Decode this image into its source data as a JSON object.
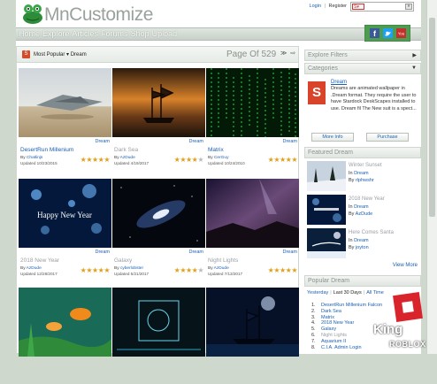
{
  "header": {
    "brand": "MnCustomize",
    "login": "Login",
    "separator": "|",
    "register": "Register",
    "search_scope": "S",
    "search_go": "»"
  },
  "nav": {
    "items": [
      "Home",
      "Explore",
      "Articles",
      "Forums",
      "Shop",
      "Upload"
    ]
  },
  "social": {
    "facebook": "f",
    "twitter": "t",
    "youtube": "You"
  },
  "toolbar": {
    "sort_label": "Most Popular",
    "category": "Dream",
    "pager": "Page Of 529",
    "arrows": "≫ ⇨"
  },
  "cards": [
    {
      "tag": "Dream",
      "title": "DesertRun Millenium",
      "author": "Chatlinjs",
      "updated": "Updated 10/23/2015",
      "rating": 5,
      "dim": false
    },
    {
      "tag": "Dream",
      "title": "Dark Sea",
      "author": "AzDude",
      "updated": "Updated 4/19/2017",
      "rating": 4,
      "dim": true
    },
    {
      "tag": "Dream",
      "title": "Matrix",
      "author": "CerGuy",
      "updated": "Updated 10/24/2010",
      "rating": 5,
      "dim": false
    },
    {
      "tag": "Dream",
      "title": "2018 New Year",
      "author": "AzDude",
      "updated": "Updated 12/28/2017",
      "rating": 5,
      "dim": true
    },
    {
      "tag": "Dream",
      "title": "Galaxy",
      "author": "cyberlobster",
      "updated": "Updated 5/21/2017",
      "rating": 4,
      "dim": true
    },
    {
      "tag": "Dream",
      "title": "Night Lights",
      "author": "AzDude",
      "updated": "Updated 7/13/2017",
      "rating": 5,
      "dim": true
    },
    {
      "tag": "",
      "title": "",
      "author": "",
      "updated": "",
      "rating": 0,
      "dim": false
    },
    {
      "tag": "",
      "title": "",
      "author": "",
      "updated": "",
      "rating": 0,
      "dim": false
    },
    {
      "tag": "",
      "title": "",
      "author": "",
      "updated": "",
      "rating": 0,
      "dim": false
    }
  ],
  "sidebar": {
    "explore_filters": "Explore Filters",
    "categories": "Categories",
    "info_name": "Dream",
    "info_desc": "Dreams are animated wallpaper in .Dream format. They require the user to have Stardock DeskScapes installed to use. Dream fil The New suit is a spect...",
    "more_info": "More Info",
    "purchase": "Purchase",
    "featured_title": "Featured Dream",
    "featured": [
      {
        "name": "Winter Sunset",
        "in": "In",
        "cat": "Dream",
        "by": "By",
        "author": "rlphwshr"
      },
      {
        "name": "2018 New Year",
        "in": "In",
        "cat": "Dream",
        "by": "By",
        "author": "AzDude"
      },
      {
        "name": "Here Comes Santa",
        "in": "In",
        "cat": "Dream",
        "by": "By",
        "author": "joyton"
      }
    ],
    "view_more": "View More",
    "popular_title": "Popular Dream",
    "tabs": [
      "Yesterday",
      "Last 30 Days",
      "All Time"
    ],
    "popular": [
      {
        "n": "1.",
        "t": "DesertRun Millenium Falcon",
        "dim": false
      },
      {
        "n": "2.",
        "t": "Dark Sea",
        "dim": false
      },
      {
        "n": "3.",
        "t": "Matrix",
        "dim": false
      },
      {
        "n": "4.",
        "t": "2018 New Year",
        "dim": false
      },
      {
        "n": "5.",
        "t": "Galaxy",
        "dim": false
      },
      {
        "n": "6.",
        "t": "Night Lights",
        "dim": true
      },
      {
        "n": "7.",
        "t": "Aquarium II",
        "dim": false
      },
      {
        "n": "8.",
        "t": "C.I.A. Admin Login",
        "dim": false
      }
    ]
  },
  "watermark": {
    "king": "King",
    "roblox": "ROBLOX"
  }
}
